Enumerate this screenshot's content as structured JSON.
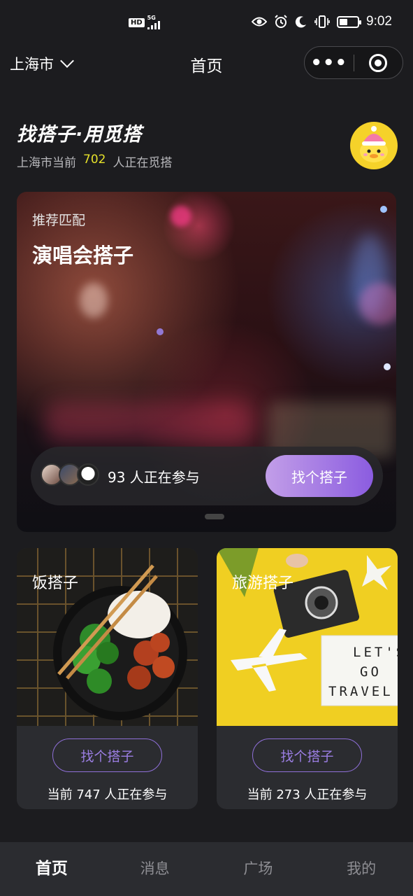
{
  "status_bar": {
    "network_badge": "HD",
    "network_type": "5G",
    "time": "9:02",
    "battery_level": 0.45
  },
  "navbar": {
    "city": "上海市",
    "title": "首页",
    "more_label": "•••"
  },
  "hero": {
    "slogan": "找搭子·用觅搭",
    "stats_prefix": "上海市当前",
    "stats_count": "702",
    "stats_suffix": "人正在觅搭"
  },
  "featured": {
    "subtitle": "推荐匹配",
    "title": "演唱会搭子",
    "participants": "93 人正在参与",
    "button": "找个搭子"
  },
  "cards": [
    {
      "title": "饭搭子",
      "button": "找个搭子",
      "participants": "当前 747 人正在参与"
    },
    {
      "title": "旅游搭子",
      "button": "找个搭子",
      "participants": "当前 273 人正在参与",
      "sign_lines": [
        "LET'S",
        "GO",
        "TRAVEL"
      ]
    }
  ],
  "tabs": [
    "首页",
    "消息",
    "广场",
    "我的"
  ],
  "colors": {
    "accent": "#8b5ce0",
    "highlight": "#e6e12a",
    "background": "#1c1c1f"
  }
}
